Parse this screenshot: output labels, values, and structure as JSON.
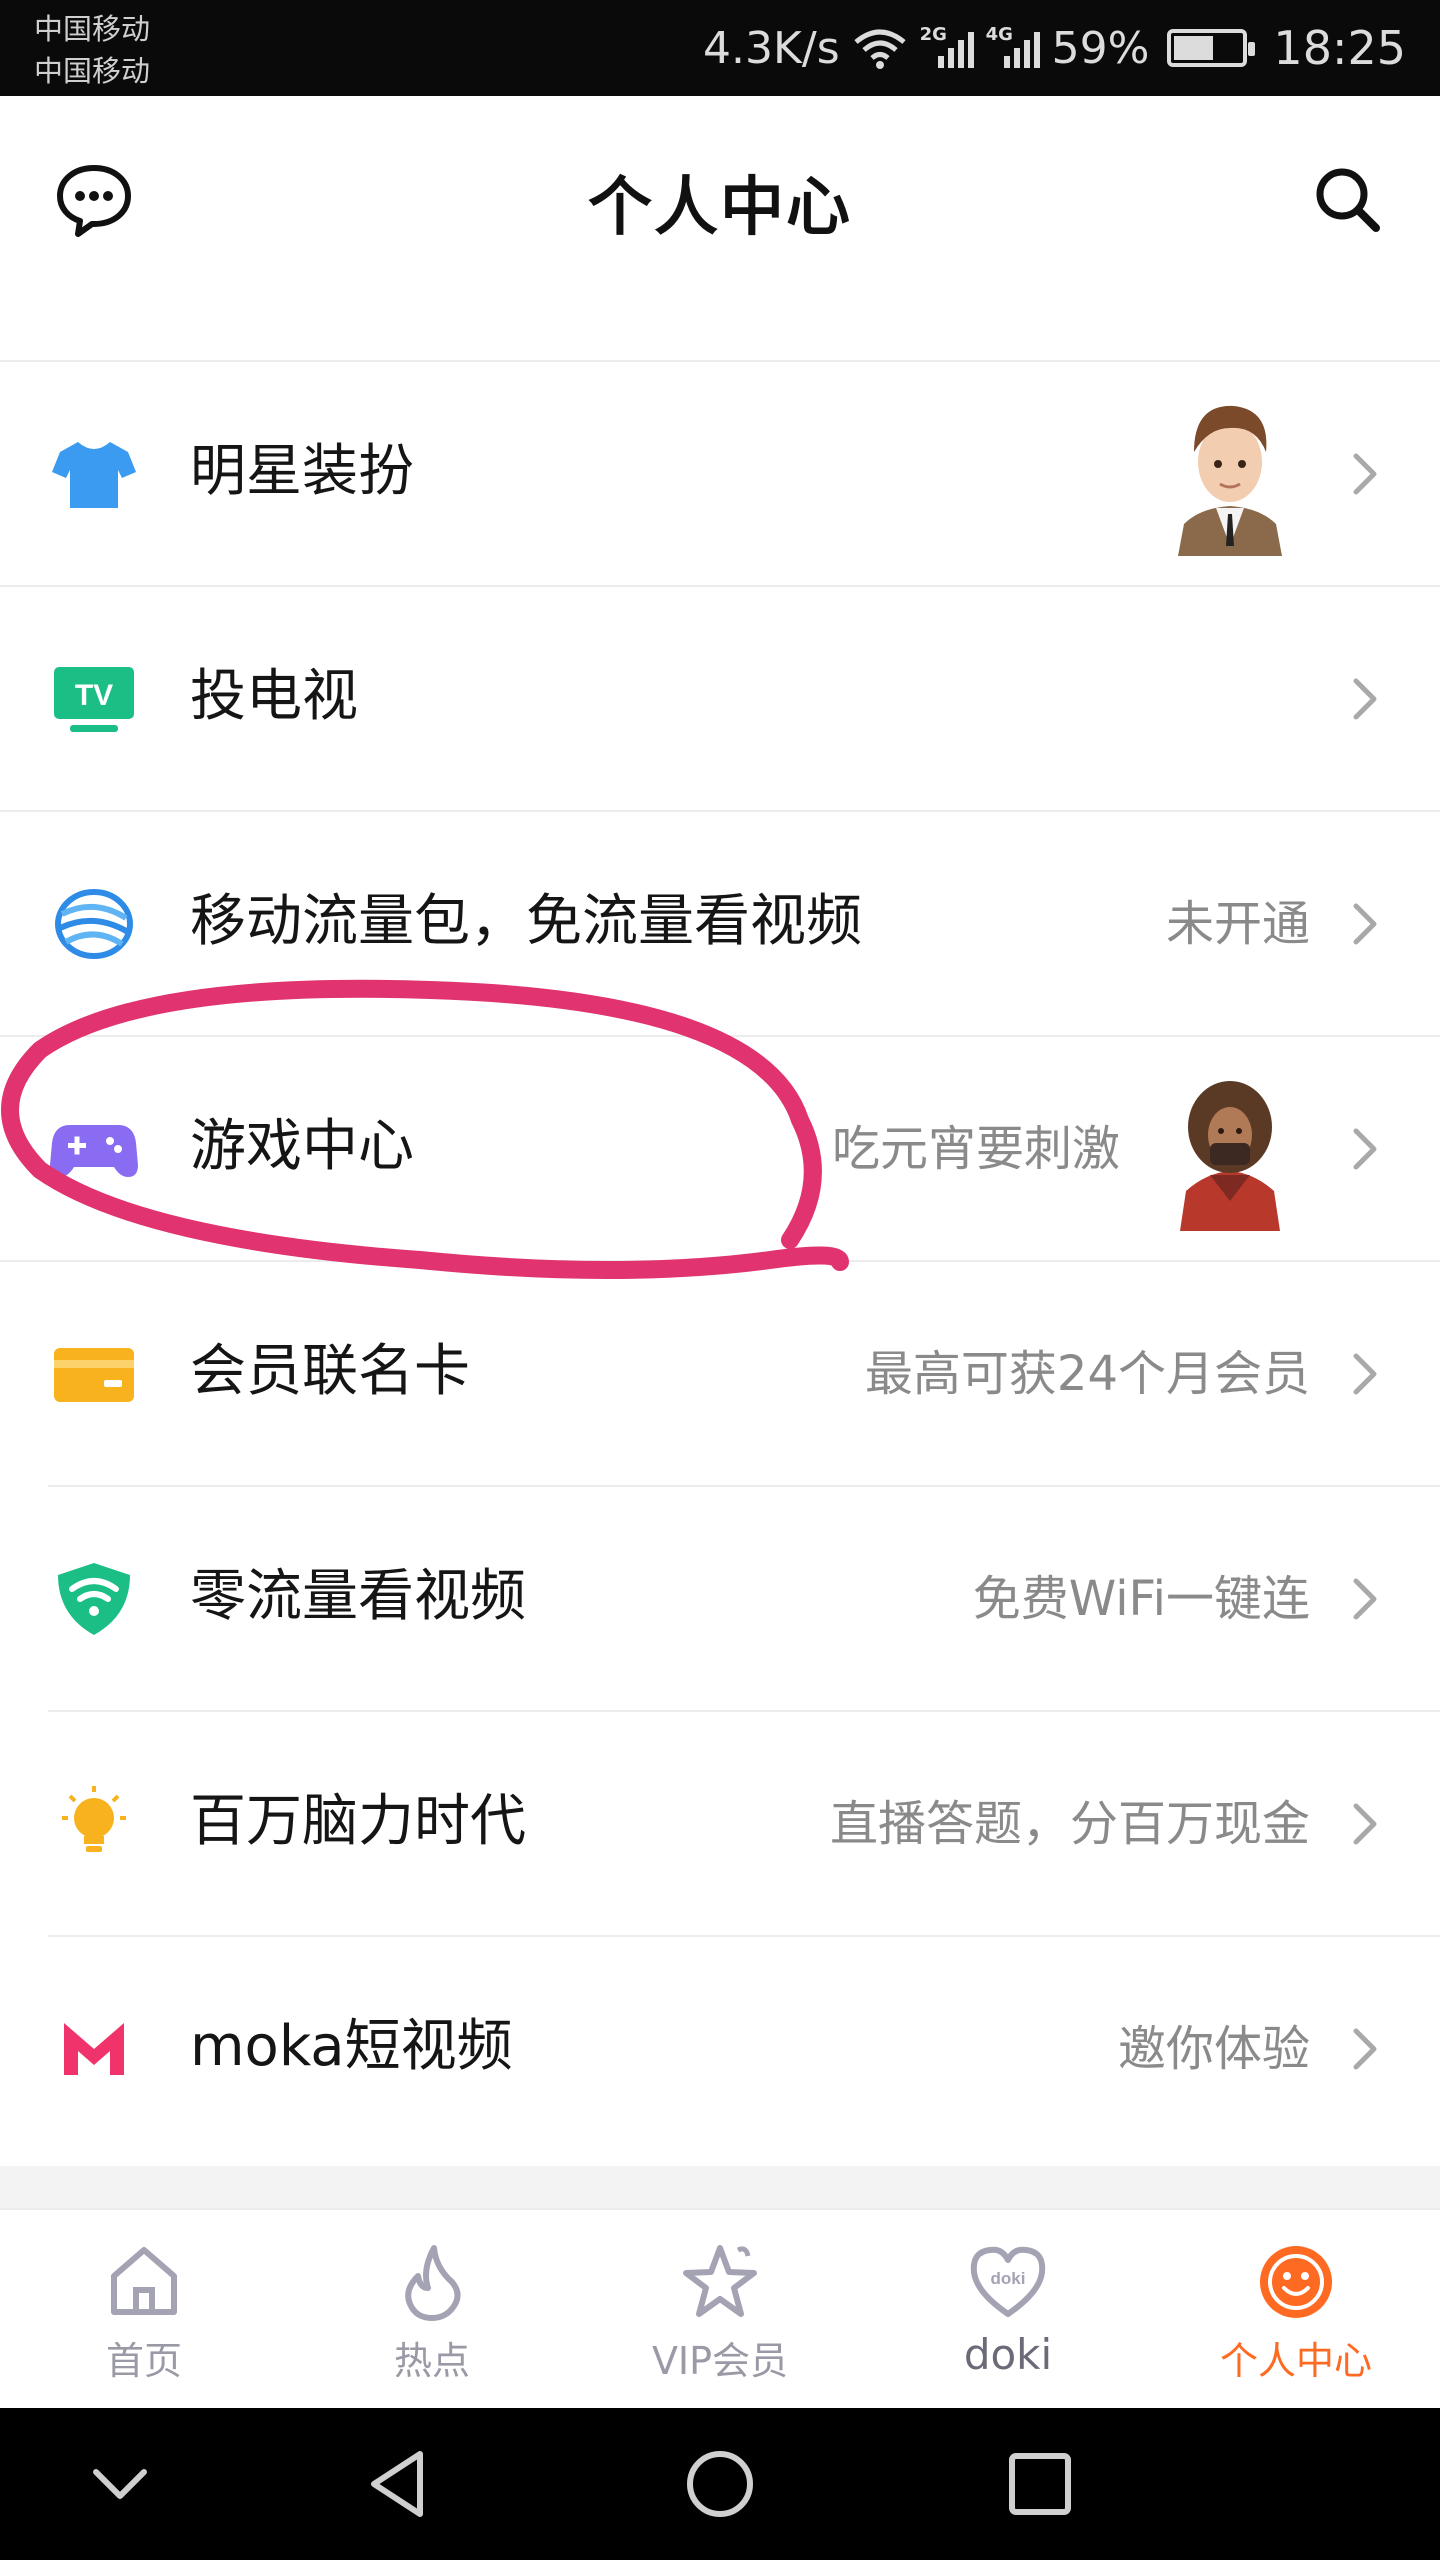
{
  "status_bar": {
    "carrier_1": "中国移动",
    "carrier_2": "中国移动",
    "speed": "4.3K/s",
    "net_2g": "2G",
    "net_4g": "4G",
    "battery_percent": "59%",
    "battery_level": 0.59,
    "time": "18:25"
  },
  "header": {
    "title": "个人中心",
    "left_icon": "chat-bubble-icon",
    "right_icon": "search-icon"
  },
  "menu": [
    {
      "label": "明星装扮",
      "sub": "",
      "icon": "tshirt-icon",
      "icon_color": "#3b9bf0",
      "has_avatar": true
    },
    {
      "label": "投电视",
      "sub": "",
      "icon": "tv-icon",
      "icon_color": "#1bbf86",
      "has_avatar": false
    },
    {
      "label": "移动流量包，免流量看视频",
      "sub": "未开通",
      "icon": "china-mobile-icon",
      "icon_color": "#2e8be6",
      "has_avatar": false
    },
    {
      "label": "游戏中心",
      "sub": "吃元宵要刺激",
      "icon": "gamepad-icon",
      "icon_color": "#8a6cf2",
      "has_avatar": true
    },
    {
      "label": "会员联名卡",
      "sub": "最高可获24个月会员",
      "icon": "card-icon",
      "icon_color": "#f7b21d",
      "has_avatar": false
    },
    {
      "label": "零流量看视频",
      "sub": "免费WiFi一键连",
      "icon": "wifi-shield-icon",
      "icon_color": "#1bbf86",
      "has_avatar": false
    },
    {
      "label": "百万脑力时代",
      "sub": "直播答题，分百万现金",
      "icon": "lightbulb-icon",
      "icon_color": "#f7b21d",
      "has_avatar": false
    },
    {
      "label": "moka短视频",
      "sub": "邀你体验",
      "icon": "moka-logo-icon",
      "icon_color": "#f0336a",
      "has_avatar": false
    }
  ],
  "bottom_nav": [
    {
      "label": "首页",
      "icon": "home-icon",
      "active": false
    },
    {
      "label": "热点",
      "icon": "flame-icon",
      "active": false
    },
    {
      "label": "VIP会员",
      "icon": "vip-star-icon",
      "active": false
    },
    {
      "label": "doki",
      "icon": "doki-heart-icon",
      "active": false
    },
    {
      "label": "个人中心",
      "icon": "smiley-icon",
      "active": true
    }
  ],
  "colors": {
    "accent": "#ff6a22",
    "annotation": "#e0336f",
    "nav_inactive": "#9a9aa6"
  }
}
